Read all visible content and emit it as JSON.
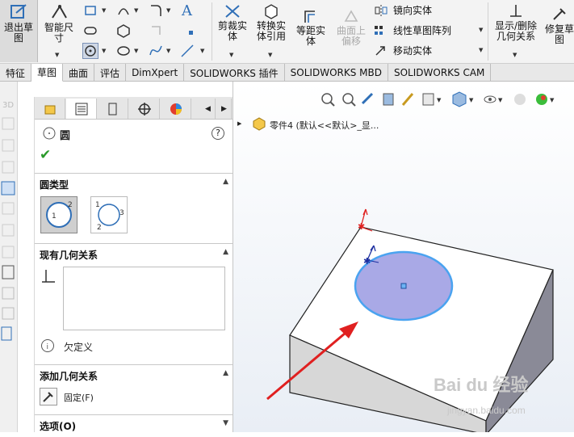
{
  "ribbon": {
    "exit_sketch": "退出草图",
    "smart_dim": "智能尺寸",
    "trim": "剪裁实体",
    "convert": "转换实体引用",
    "offset": "等距实体",
    "surface_offset": "曲面上偏移",
    "mirror": "镜向实体",
    "linear_pattern": "线性草图阵列",
    "move": "移动实体",
    "show_relations": "显示/删除几何关系",
    "repair": "修复草图"
  },
  "tabs": [
    "特征",
    "草图",
    "曲面",
    "评估",
    "DimXpert",
    "SOLIDWORKS 插件",
    "SOLIDWORKS MBD",
    "SOLIDWORKS CAM"
  ],
  "active_tab": "草图",
  "panel": {
    "title": "圆",
    "help": "?",
    "circle_type_title": "圆类型",
    "existing_relations_title": "现有几何关系",
    "status": "欠定义",
    "add_relations_title": "添加几何关系",
    "fix_label": "固定(F)",
    "options_title": "选项(O)"
  },
  "tree": {
    "part_label": "零件4 (默认<<默认>_显..."
  },
  "colors": {
    "accent": "#2f6fb7",
    "circle_fill": "#a9a9e6",
    "circle_stroke": "#4aa3f0",
    "arrow": "#e02020"
  },
  "watermark": {
    "brand": "Bai du 经验",
    "url": "jingyan.baidu.com"
  }
}
